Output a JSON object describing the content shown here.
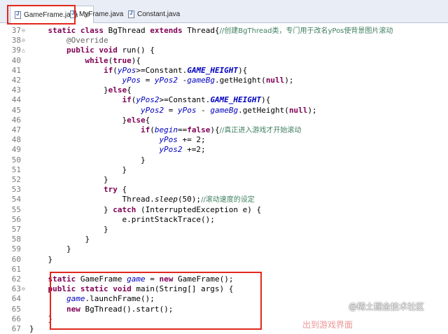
{
  "tabs": [
    {
      "label": "GameFrame.java",
      "close": "☒"
    },
    {
      "label": "MyFrame.java"
    },
    {
      "label": "Constant.java"
    }
  ],
  "lines": [
    {
      "n": "37",
      "fold": "⊖",
      "segs": [
        [
          "",
          "    "
        ],
        [
          "kw",
          "static class"
        ],
        [
          "",
          " BgThread "
        ],
        [
          "kw",
          "extends"
        ],
        [
          "",
          " Thread{"
        ],
        [
          "cmt",
          "//创建BgThread类，专门用于改名yPos使背景图片滚动"
        ]
      ]
    },
    {
      "n": "38",
      "fold": "⊖",
      "segs": [
        [
          "",
          "        "
        ],
        [
          "ann",
          "@Override"
        ]
      ]
    },
    {
      "n": "39",
      "fold": "△",
      "segs": [
        [
          "",
          "        "
        ],
        [
          "kw",
          "public void"
        ],
        [
          "",
          " run() {"
        ]
      ]
    },
    {
      "n": "40",
      "segs": [
        [
          "",
          "            "
        ],
        [
          "kw",
          "while"
        ],
        [
          "",
          "("
        ],
        [
          "kw",
          "true"
        ],
        [
          "",
          "){"
        ]
      ]
    },
    {
      "n": "41",
      "segs": [
        [
          "",
          "                "
        ],
        [
          "kw",
          "if"
        ],
        [
          "",
          "("
        ],
        [
          "fld",
          "yPos"
        ],
        [
          "",
          ">=Constant."
        ],
        [
          "cst",
          "GAME_HEIGHT"
        ],
        [
          "",
          "){"
        ]
      ]
    },
    {
      "n": "42",
      "segs": [
        [
          "",
          "                    "
        ],
        [
          "fld",
          "yPos"
        ],
        [
          "",
          " = "
        ],
        [
          "fld",
          "yPos2"
        ],
        [
          "",
          " -"
        ],
        [
          "fld",
          "gameBg"
        ],
        [
          "",
          ".getHeight("
        ],
        [
          "kw",
          "null"
        ],
        [
          "",
          ");"
        ]
      ]
    },
    {
      "n": "43",
      "segs": [
        [
          "",
          "                }"
        ],
        [
          "kw",
          "else"
        ],
        [
          "",
          "{"
        ]
      ]
    },
    {
      "n": "44",
      "segs": [
        [
          "",
          "                    "
        ],
        [
          "kw",
          "if"
        ],
        [
          "",
          "("
        ],
        [
          "fld",
          "yPos2"
        ],
        [
          "",
          ">=Constant."
        ],
        [
          "cst",
          "GAME_HEIGHT"
        ],
        [
          "",
          "){"
        ]
      ]
    },
    {
      "n": "45",
      "segs": [
        [
          "",
          "                        "
        ],
        [
          "fld",
          "yPos2"
        ],
        [
          "",
          " = "
        ],
        [
          "fld",
          "yPos"
        ],
        [
          "",
          " - "
        ],
        [
          "fld",
          "gameBg"
        ],
        [
          "",
          ".getHeight("
        ],
        [
          "kw",
          "null"
        ],
        [
          "",
          ");"
        ]
      ]
    },
    {
      "n": "46",
      "segs": [
        [
          "",
          "                    }"
        ],
        [
          "kw",
          "else"
        ],
        [
          "",
          "{"
        ]
      ]
    },
    {
      "n": "47",
      "segs": [
        [
          "",
          "                        "
        ],
        [
          "kw",
          "if"
        ],
        [
          "",
          "("
        ],
        [
          "fld",
          "begin"
        ],
        [
          "",
          "=="
        ],
        [
          "kw",
          "false"
        ],
        [
          "",
          "){"
        ],
        [
          "cmt",
          "//真正进入游戏才开始滚动"
        ]
      ]
    },
    {
      "n": "48",
      "segs": [
        [
          "",
          "                            "
        ],
        [
          "fld",
          "yPos"
        ],
        [
          "",
          " += 2;"
        ]
      ]
    },
    {
      "n": "49",
      "segs": [
        [
          "",
          "                            "
        ],
        [
          "fld",
          "yPos2"
        ],
        [
          "",
          " +=2;"
        ]
      ]
    },
    {
      "n": "50",
      "segs": [
        [
          "",
          "                        }"
        ]
      ]
    },
    {
      "n": "51",
      "segs": [
        [
          "",
          "                    }"
        ]
      ]
    },
    {
      "n": "52",
      "segs": [
        [
          "",
          "                }"
        ]
      ]
    },
    {
      "n": "53",
      "segs": [
        [
          "",
          "                "
        ],
        [
          "kw",
          "try"
        ],
        [
          "",
          " {"
        ]
      ]
    },
    {
      "n": "54",
      "segs": [
        [
          "",
          "                    Thread."
        ],
        [
          "mth",
          "sleep"
        ],
        [
          "",
          "(50);"
        ],
        [
          "cmt",
          "//滚动速度的设定"
        ]
      ]
    },
    {
      "n": "55",
      "segs": [
        [
          "",
          "                } "
        ],
        [
          "kw",
          "catch"
        ],
        [
          "",
          " (InterruptedException e) {"
        ]
      ]
    },
    {
      "n": "56",
      "segs": [
        [
          "",
          "                    e.printStackTrace();"
        ]
      ]
    },
    {
      "n": "57",
      "segs": [
        [
          "",
          "                }"
        ]
      ]
    },
    {
      "n": "58",
      "segs": [
        [
          "",
          "            }"
        ]
      ]
    },
    {
      "n": "59",
      "segs": [
        [
          "",
          "        }"
        ]
      ]
    },
    {
      "n": "60",
      "segs": [
        [
          "",
          "    }"
        ]
      ]
    },
    {
      "n": "61",
      "segs": [
        [
          "",
          ""
        ]
      ]
    },
    {
      "n": "62",
      "segs": [
        [
          "",
          "    "
        ],
        [
          "kw",
          "static"
        ],
        [
          "",
          " GameFrame "
        ],
        [
          "fld",
          "game"
        ],
        [
          "",
          " = "
        ],
        [
          "kw",
          "new"
        ],
        [
          "",
          " GameFrame();"
        ]
      ]
    },
    {
      "n": "63",
      "fold": "⊖",
      "segs": [
        [
          "",
          "    "
        ],
        [
          "kw",
          "public static void"
        ],
        [
          "",
          " main(String[] args) {"
        ]
      ]
    },
    {
      "n": "64",
      "segs": [
        [
          "",
          "        "
        ],
        [
          "fld",
          "game"
        ],
        [
          "",
          ".launchFrame();"
        ]
      ]
    },
    {
      "n": "65",
      "segs": [
        [
          "",
          "        "
        ],
        [
          "kw",
          "new"
        ],
        [
          "",
          " BgThread().start();"
        ]
      ]
    },
    {
      "n": "66",
      "segs": [
        [
          "",
          "    }"
        ]
      ]
    },
    {
      "n": "67",
      "segs": [
        [
          "",
          "}"
        ]
      ]
    }
  ],
  "watermark": "@稀土掘金技术社区",
  "watermark_partial": "出到游戏界面",
  "colors": {
    "keyword": "#7f0055",
    "field": "#0000c0",
    "comment": "#3f7f5f",
    "highlight_box": "#e0281e"
  }
}
